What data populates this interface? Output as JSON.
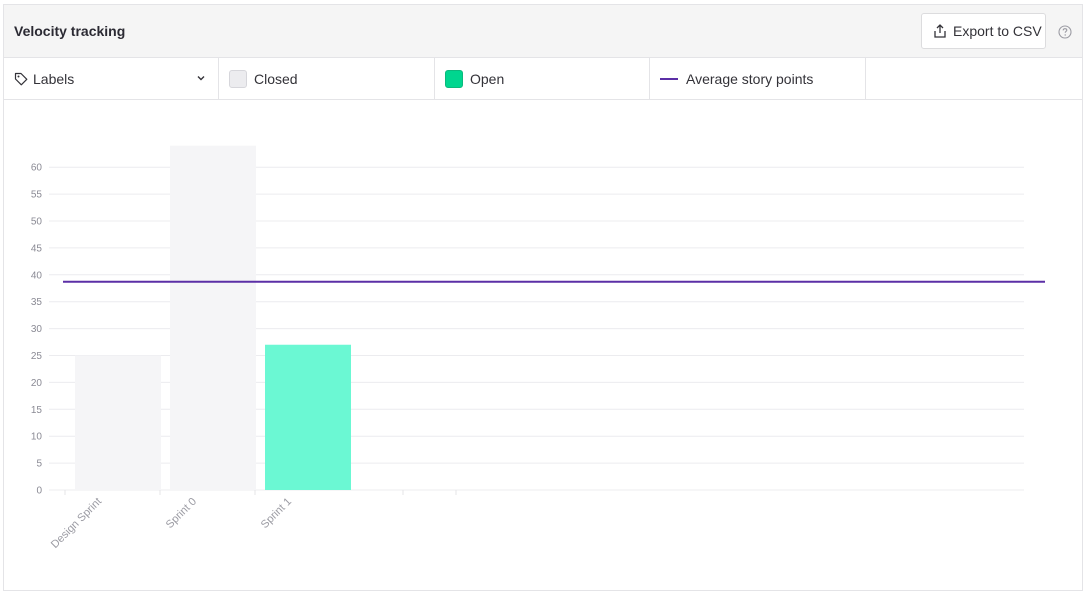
{
  "header": {
    "title": "Velocity tracking",
    "export_label": "Export to CSV"
  },
  "legend": {
    "labels_label": "Labels",
    "closed_label": "Closed",
    "open_label": "Open",
    "avg_label": "Average story points"
  },
  "icons": {
    "labels": "tag-icon",
    "export": "export-icon",
    "help": "help-icon",
    "dropdown": "chevron-down-icon"
  },
  "colors": {
    "closed": "#f5f5f7",
    "open": "#6bf8d3",
    "average": "#5b2fa6"
  },
  "chart_data": {
    "type": "bar",
    "categories": [
      "Design Sprint",
      "Sprint 0",
      "Sprint 1",
      ""
    ],
    "series": [
      {
        "name": "Closed",
        "values": [
          25,
          64,
          0,
          0
        ]
      },
      {
        "name": "Open",
        "values": [
          0,
          0,
          27,
          0
        ]
      }
    ],
    "average_story_points": 38.7,
    "yticks": [
      0,
      5,
      10,
      15,
      20,
      25,
      30,
      35,
      40,
      45,
      50,
      55,
      60
    ],
    "ylim": [
      0,
      64
    ],
    "grid": true
  }
}
